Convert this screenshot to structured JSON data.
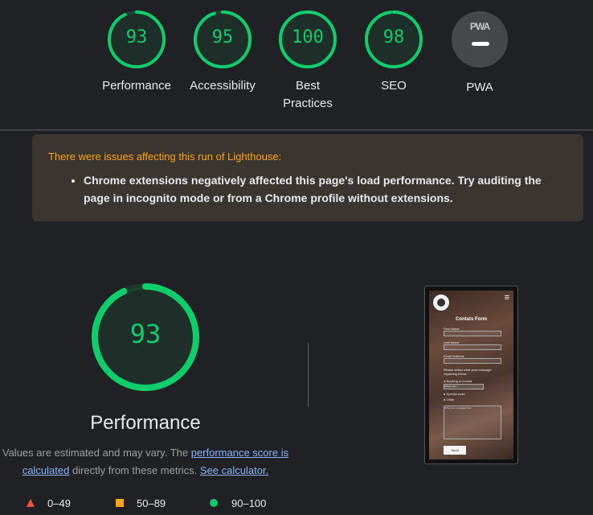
{
  "categories": [
    {
      "id": "performance",
      "score": "93",
      "score_value": 93,
      "label": "Performance"
    },
    {
      "id": "accessibility",
      "score": "95",
      "score_value": 95,
      "label": "Accessibility"
    },
    {
      "id": "best-practices",
      "score": "100",
      "score_value": 100,
      "label": "Best Practices"
    },
    {
      "id": "seo",
      "score": "98",
      "score_value": 98,
      "label": "SEO"
    }
  ],
  "pwa": {
    "badge_text": "PWA",
    "label": "PWA"
  },
  "warning": {
    "title": "There were issues affecting this run of Lighthouse:",
    "items": [
      "Chrome extensions negatively affected this page's load performance. Try auditing the page in incognito mode or from a Chrome profile without extensions."
    ]
  },
  "performance_detail": {
    "score": "93",
    "score_value": 93,
    "title": "Performance",
    "desc_prefix": "Values are estimated and may vary. The ",
    "desc_link1": "performance score is calculated",
    "desc_middle": " directly from these metrics. ",
    "desc_link2": "See calculator."
  },
  "legend": [
    {
      "icon": "triangle-icon",
      "range": "0–49",
      "color": "#ff4e42"
    },
    {
      "icon": "square-icon",
      "range": "50–89",
      "color": "#ffa400"
    },
    {
      "icon": "circle-icon",
      "range": "90–100",
      "color": "#0cce6b"
    }
  ],
  "colors": {
    "pass": "#0cce6b",
    "average": "#ffa400",
    "fail": "#ff4e42",
    "warning_text": "#ffa400",
    "link": "#8ab4f8"
  },
  "screenshot": {
    "title": "Contats Form",
    "fields": [
      "First Name",
      "Last Name",
      "Email Address"
    ],
    "message_prompt": "Please select what your message regarding below",
    "radios": [
      "Booking a Course",
      "Special order",
      "Other"
    ],
    "select_value": "Select here",
    "textarea_placeholder": "Write your message here",
    "send_label": "Send",
    "menu_icon": "≡"
  }
}
